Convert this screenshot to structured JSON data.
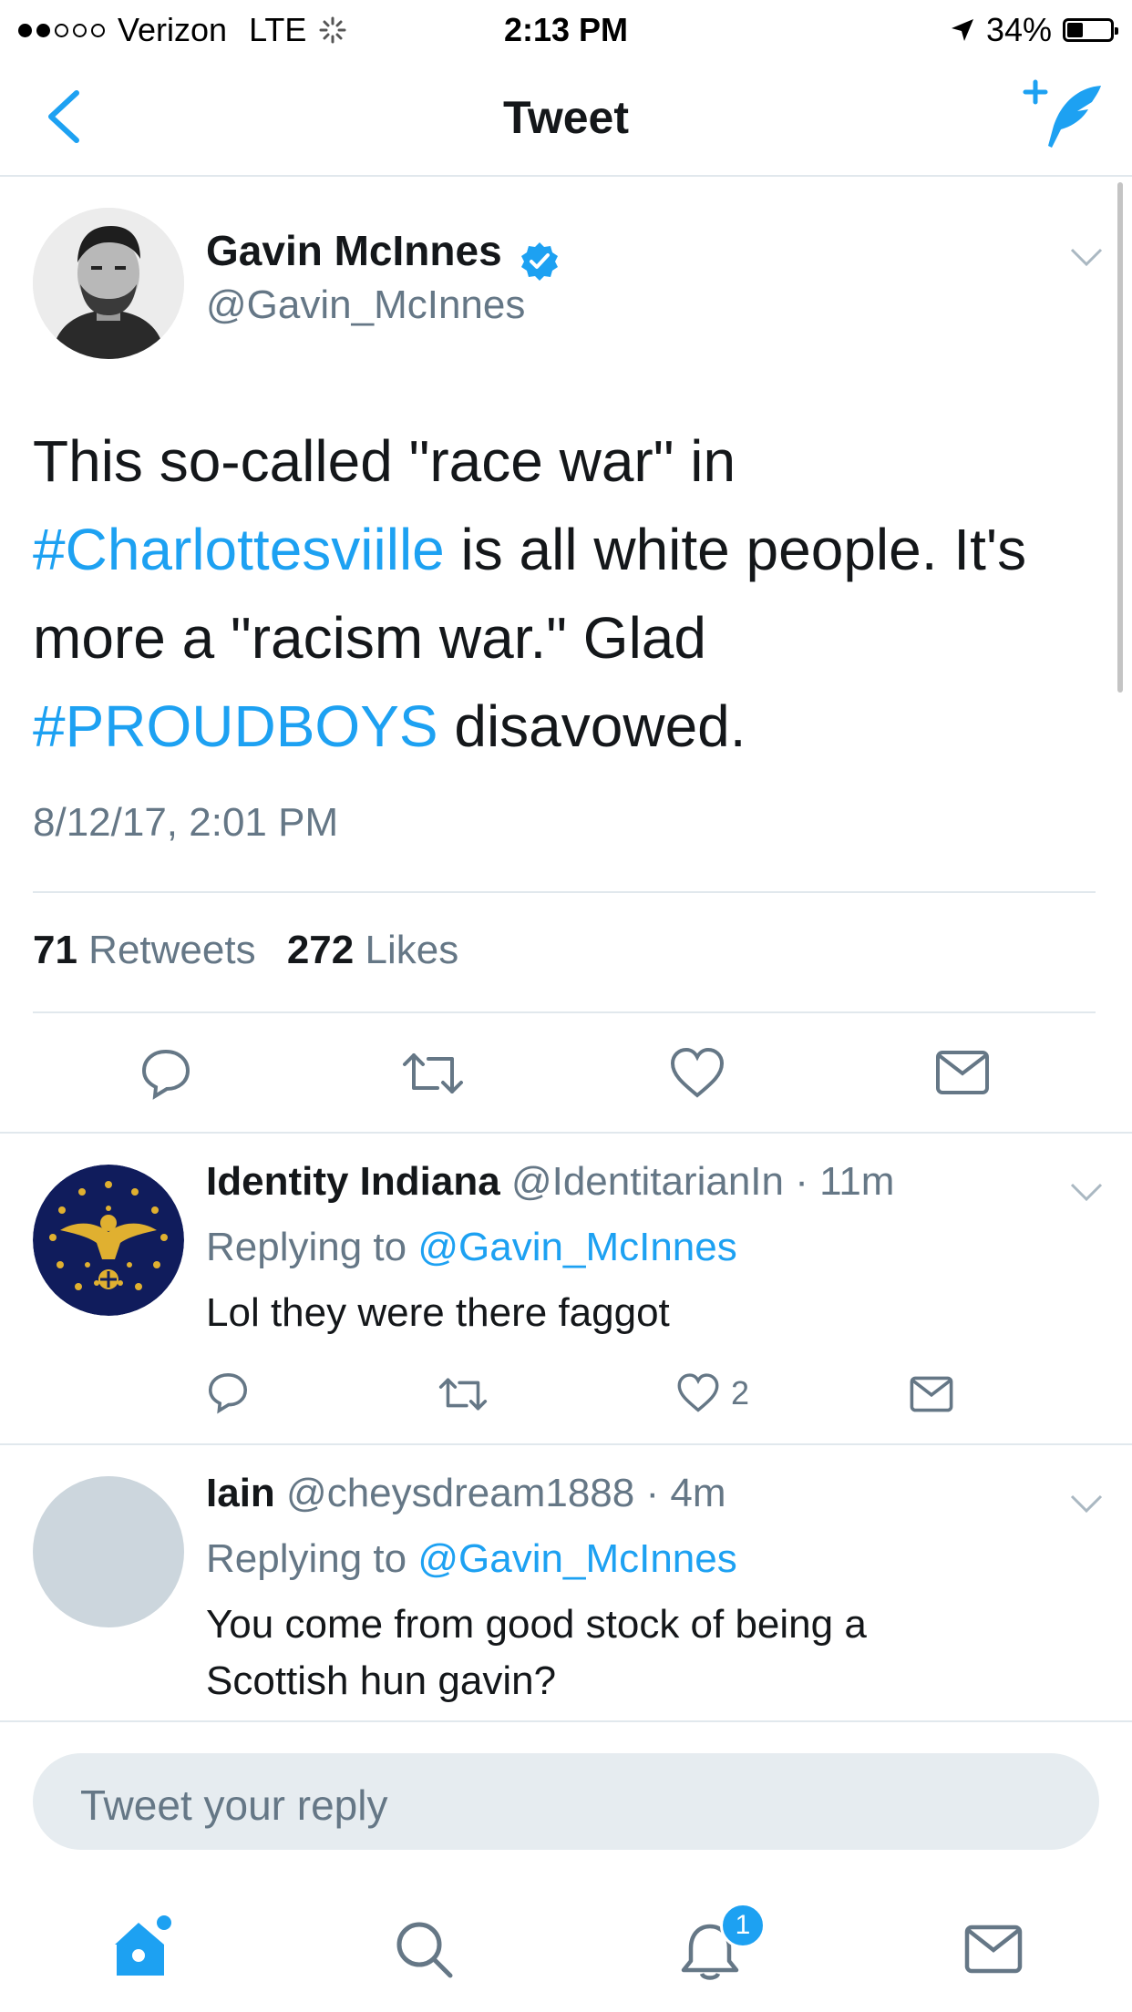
{
  "status_bar": {
    "carrier": "Verizon",
    "network": "LTE",
    "time": "2:13 PM",
    "battery": "34%",
    "signal_bars": 2
  },
  "nav": {
    "title": "Tweet",
    "back_icon": "chevron-left-icon",
    "compose_icon": "compose-tweet-icon"
  },
  "tweet": {
    "author_name": "Gavin McInnes",
    "author_handle": "@Gavin_McInnes",
    "verified": true,
    "text_line1": "This so-called \"race war\" in",
    "hashtag1": "#Charlottesviille",
    "text_line2_rest": " is all white people. It's",
    "text_line3": "more a \"racism war.\" Glad",
    "hashtag2": "#PROUDBOYS",
    "text_line4_rest": " disavowed.",
    "timestamp": "8/12/17, 2:01 PM",
    "retweets_count": "71",
    "retweets_label": " Retweets",
    "likes_count": "272",
    "likes_label": " Likes"
  },
  "replies": [
    {
      "name": "Identity Indiana",
      "handle": "@IdentitarianIn",
      "separator": " · ",
      "time": "11m",
      "replying_label": "Replying to ",
      "replying_to": "@Gavin_McInnes",
      "text": "Lol they were there faggot",
      "like_count": "2"
    },
    {
      "name": "Iain",
      "handle": "@cheysdream1888",
      "separator": " · ",
      "time": "4m",
      "replying_label": "Replying to ",
      "replying_to": "@Gavin_McInnes",
      "text_line1": "You come from good stock of being a",
      "text_line2": "Scottish hun gavin?"
    }
  ],
  "reply_input": {
    "placeholder": "Tweet your reply"
  },
  "tabbar": {
    "items": [
      "home-icon",
      "search-icon",
      "notifications-icon",
      "messages-icon"
    ],
    "notification_badge": "1"
  },
  "colors": {
    "accent": "#1da1f2",
    "text": "#14171a",
    "secondary": "#657786",
    "divider": "#e1e8ed"
  }
}
